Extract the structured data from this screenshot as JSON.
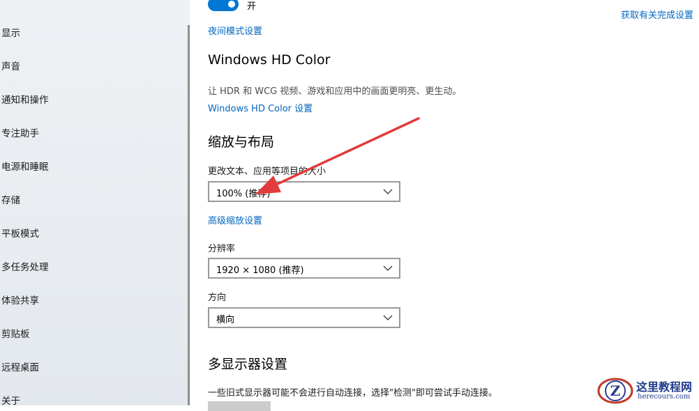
{
  "sidebar": {
    "items": [
      {
        "label": "显示"
      },
      {
        "label": "声音"
      },
      {
        "label": "通知和操作"
      },
      {
        "label": "专注助手"
      },
      {
        "label": "电源和睡眠"
      },
      {
        "label": "存储"
      },
      {
        "label": "平板模式"
      },
      {
        "label": "多任务处理"
      },
      {
        "label": "体验共享"
      },
      {
        "label": "剪贴板"
      },
      {
        "label": "远程桌面"
      },
      {
        "label": "关于"
      }
    ]
  },
  "main": {
    "night_light_toggle": {
      "state_label": "开",
      "on": true
    },
    "night_light_settings_link": "夜间模式设置",
    "get_help_link": "获取有关完成设置",
    "hdr": {
      "title": "Windows HD Color",
      "description": "让 HDR 和 WCG 视频、游戏和应用中的画面更明亮、更生动。",
      "link": "Windows HD Color 设置"
    },
    "scale": {
      "title": "缩放与布局",
      "scale_label": "更改文本、应用等项目的大小",
      "scale_value": "100% (推荐)",
      "advanced_link": "高级缩放设置",
      "resolution_label": "分辨率",
      "resolution_value": "1920 × 1080 (推荐)",
      "orientation_label": "方向",
      "orientation_value": "横向"
    },
    "multi_display": {
      "title": "多显示器设置",
      "description": "一些旧式显示器可能不会进行自动连接，选择\"检测\"即可尝试手动连接。"
    }
  },
  "watermark": {
    "logo_letter": "Z",
    "title": "这里教程网",
    "url": "herecours.com"
  },
  "colors": {
    "accent": "#0078d4",
    "link": "#0067c0",
    "annotation_arrow": "#e23b3b"
  }
}
